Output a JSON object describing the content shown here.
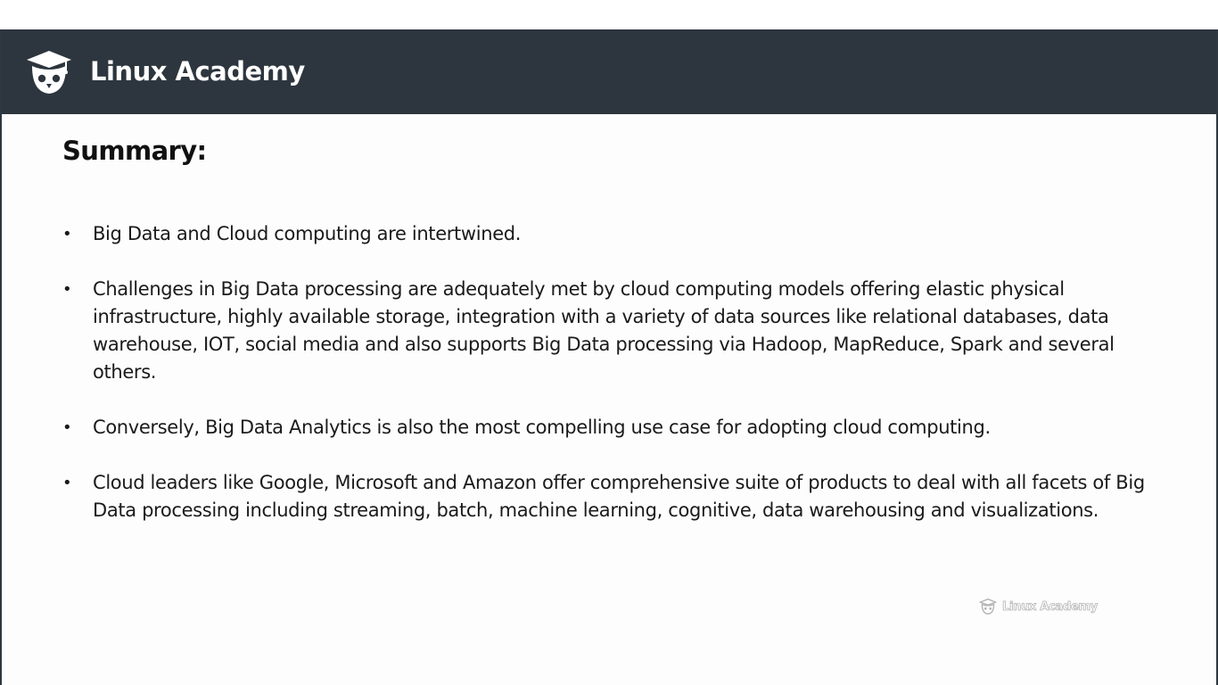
{
  "header": {
    "brand": "Linux Academy",
    "logo_icon": "owl-graduation-cap-icon"
  },
  "slide": {
    "title": "Summary:",
    "bullets": [
      "Big Data and Cloud computing are intertwined.",
      "Challenges in Big Data processing are adequately met by cloud computing models offering elastic physical infrastructure, highly available storage, integration with a variety of data sources like relational databases, data warehouse, IOT, social media  and also supports Big Data processing via Hadoop, MapReduce, Spark and several others.",
      "Conversely, Big Data Analytics is also the most compelling use case for adopting cloud computing.",
      "Cloud leaders like Google, Microsoft and Amazon offer comprehensive suite of products to deal with all facets of Big Data processing including streaming, batch, machine learning, cognitive, data warehousing and visualizations."
    ],
    "bullet_symbol": "•"
  },
  "watermark": {
    "text": "Linux Academy",
    "icon": "owl-logo-icon"
  },
  "colors": {
    "header_bg": "#2d363e",
    "header_text": "#ffffff",
    "slide_bg": "#fdfdfd",
    "body_text": "#1a1a1a"
  }
}
